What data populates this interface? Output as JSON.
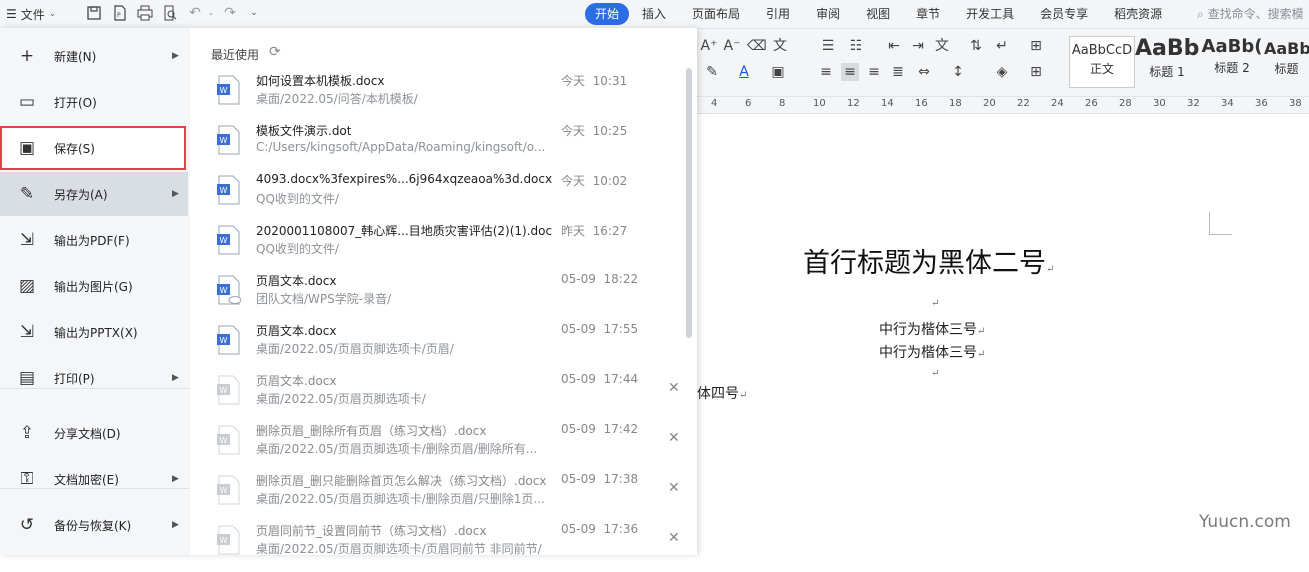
{
  "topbar": {
    "menu_label": "文件",
    "tabs": [
      "开始",
      "插入",
      "页面布局",
      "引用",
      "审阅",
      "视图",
      "章节",
      "开发工具",
      "会员专享",
      "稻壳资源"
    ],
    "search_placeholder": "查找命令、搜索模"
  },
  "ribbon": {
    "styles": [
      {
        "sample": "AaBbCcD",
        "name": "正文"
      },
      {
        "sample": "AaBb",
        "name": "标题 1"
      },
      {
        "sample": "AaBb(",
        "name": "标题 2"
      },
      {
        "sample": "AaBb",
        "name": "标题"
      }
    ],
    "ruler_ticks": [
      "4",
      "6",
      "8",
      "10",
      "12",
      "14",
      "16",
      "18",
      "20",
      "22",
      "24",
      "26",
      "28",
      "30",
      "32",
      "34",
      "36",
      "38"
    ]
  },
  "file_menu": {
    "items": [
      {
        "label": "新建(N)",
        "icon": "new-doc-icon",
        "arrow": true
      },
      {
        "label": "打开(O)",
        "icon": "folder-icon",
        "arrow": false
      },
      {
        "label": "保存(S)",
        "icon": "save-icon",
        "arrow": false
      },
      {
        "label": "另存为(A)",
        "icon": "save-as-icon",
        "arrow": true
      },
      {
        "label": "输出为PDF(F)",
        "icon": "pdf-export-icon",
        "arrow": false
      },
      {
        "label": "输出为图片(G)",
        "icon": "image-export-icon",
        "arrow": false
      },
      {
        "label": "输出为PPTX(X)",
        "icon": "pptx-export-icon",
        "arrow": false
      },
      {
        "label": "打印(P)",
        "icon": "print-icon",
        "arrow": true
      },
      {
        "label": "分享文档(D)",
        "icon": "share-icon",
        "arrow": false
      },
      {
        "label": "文档加密(E)",
        "icon": "lock-icon",
        "arrow": true
      },
      {
        "label": "备份与恢复(K)",
        "icon": "backup-icon",
        "arrow": true
      }
    ]
  },
  "recent": {
    "title": "最近使用",
    "files": [
      {
        "name": "如何设置本机模板.docx",
        "path": "桌面/2022.05/问答/本机模板/",
        "day": "今天",
        "time": "10:31",
        "type": "docx",
        "close": false
      },
      {
        "name": "模板文件演示.dot",
        "path": "C:/Users/kingsoft/AppData/Roaming/kingsoft/o...",
        "day": "今天",
        "time": "10:25",
        "type": "dot",
        "close": false
      },
      {
        "name": "4093.docx%3fexpires%...6j964xqzeaoa%3d.docx",
        "path": "QQ收到的文件/",
        "day": "今天",
        "time": "10:02",
        "type": "docx",
        "close": false
      },
      {
        "name": "2020001108007_韩心辉...目地质灾害评估(2)(1).doc",
        "path": "QQ收到的文件/",
        "day": "昨天",
        "time": "16:27",
        "type": "docx",
        "close": false
      },
      {
        "name": "页眉文本.docx",
        "path": "团队文档/WPS学院-录音/",
        "day": "05-09",
        "time": "18:22",
        "type": "cloud",
        "close": false
      },
      {
        "name": "页眉文本.docx",
        "path": "桌面/2022.05/页眉页脚选项卡/页眉/",
        "day": "05-09",
        "time": "17:55",
        "type": "docx",
        "close": false
      },
      {
        "name": "页眉文本.docx",
        "path": "桌面/2022.05/页眉页脚选项卡/",
        "day": "05-09",
        "time": "17:44",
        "type": "faded",
        "close": true
      },
      {
        "name": "删除页眉_删除所有页眉（练习文档）.docx",
        "path": "桌面/2022.05/页眉页脚选项卡/删除页眉/删除所有...",
        "day": "05-09",
        "time": "17:42",
        "type": "faded",
        "close": true
      },
      {
        "name": "删除页眉_删只能删除首页怎么解决（练习文档）.docx",
        "path": "桌面/2022.05/页眉页脚选项卡/删除页眉/只删除1页...",
        "day": "05-09",
        "time": "17:38",
        "type": "faded",
        "close": true
      },
      {
        "name": "页眉同前节_设置同前节（练习文档）.docx",
        "path": "桌面/2022.05/页眉页脚选项卡/页眉同前节 非同前节/",
        "day": "05-09",
        "time": "17:36",
        "type": "faded",
        "close": true
      }
    ]
  },
  "document": {
    "title": "首行标题为黑体二号",
    "line1": "中行为楷体三号",
    "line2": "中行为楷体三号",
    "line3": "宋体四号",
    "para_mark": "↵"
  },
  "watermark": "Yuucn.com"
}
